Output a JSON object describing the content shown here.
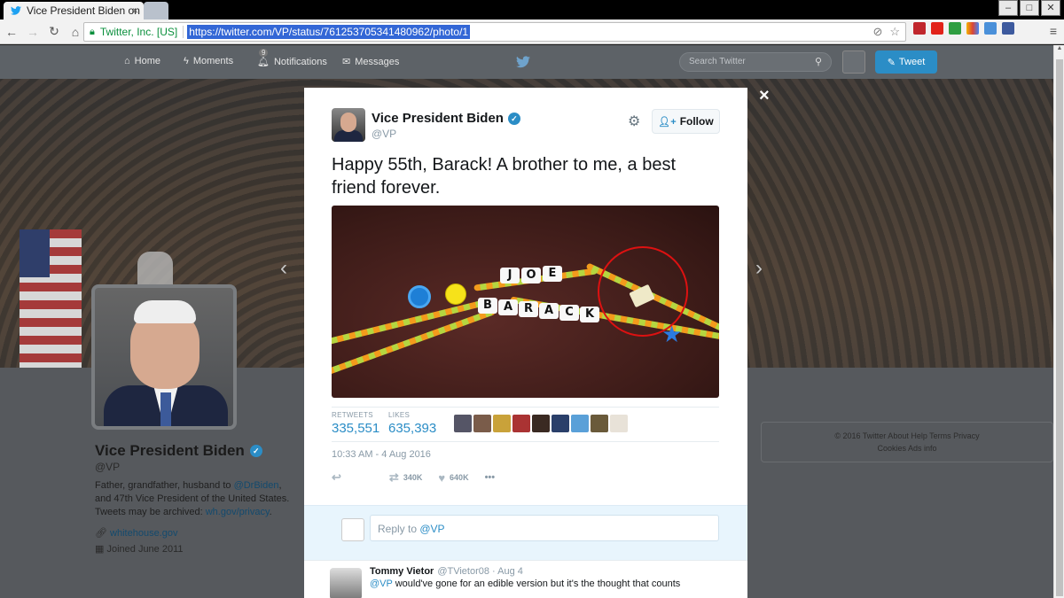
{
  "browser": {
    "tab_title": "Vice President Biden on",
    "tab_close": "×",
    "site_identity": "Twitter, Inc. [US]",
    "url": "https://twitter.com/VP/status/761253705341480962/photo/1"
  },
  "twitter_nav": {
    "home": "Home",
    "moments": "Moments",
    "notifications": "Notifications",
    "notifications_badge": "9",
    "messages": "Messages",
    "search_placeholder": "Search Twitter",
    "tweet_button": "Tweet"
  },
  "profile": {
    "name": "Vice President Biden",
    "handle": "@VP",
    "bio_1": "Father, grandfather, husband to ",
    "bio_link_1": "@DrBiden",
    "bio_2": ", and 47th Vice President of the United States. Tweets may be archived: ",
    "bio_link_2": "wh.gov/privacy",
    "bio_end": ".",
    "website": "whitehouse.gov",
    "joined": "Joined June 2011"
  },
  "footer": {
    "line1": "© 2016 Twitter  About  Help  Terms  Privacy",
    "line2": "Cookies  Ads info"
  },
  "modal": {
    "close": "×",
    "name": "Vice President Biden",
    "handle": "@VP",
    "follow": "Follow",
    "text": "Happy 55th, Barack! A brother to me, a best friend forever.",
    "photo_beads_top": [
      "J",
      "O",
      "E"
    ],
    "photo_beads_bottom": [
      "B",
      "A",
      "R",
      "A",
      "C",
      "K"
    ],
    "retweets_label": "RETWEETS",
    "retweets": "335,551",
    "likes_label": "LIKES",
    "likes": "635,393",
    "timestamp": "10:33 AM - 4 Aug 2016",
    "retweet_count": "340K",
    "like_count": "640K",
    "more": "•••",
    "reply_placeholder": "Reply to ",
    "reply_handle": "@VP",
    "reply": {
      "name": "Tommy Vietor",
      "handle": "@TVietor08 · Aug 4",
      "mention": "@VP",
      "text": " would've gone for an edible version but it's the thought that counts"
    }
  },
  "colors": {
    "twitter_blue": "#2b8dc6",
    "overlay": "#555c62"
  }
}
